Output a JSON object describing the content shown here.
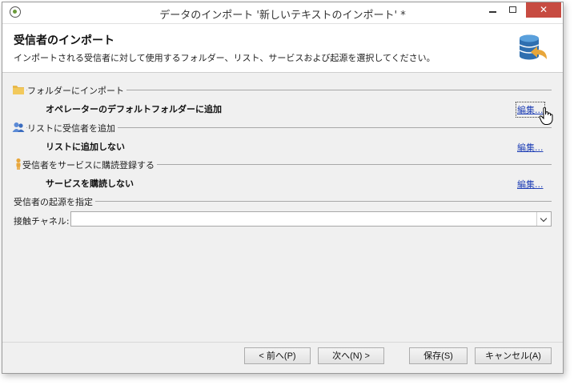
{
  "window": {
    "title": "データのインポート '新しいテキストのインポート' *",
    "close_glyph": "✕"
  },
  "header": {
    "title": "受信者のインポート",
    "subtitle": "インポートされる受信者に対して使用するフォルダー、リスト、サービスおよび起源を選択してください。"
  },
  "sections": {
    "folder": {
      "label": "フォルダーにインポート",
      "value": "オペレーターのデフォルトフォルダーに追加",
      "edit": "編集..."
    },
    "list": {
      "label": "リストに受信者を追加",
      "value": "リストに追加しない",
      "edit": "編集..."
    },
    "service": {
      "label": "受信者をサービスに購読登録する",
      "value": "サービスを購読しない",
      "edit": "編集..."
    },
    "origin": {
      "label": "受信者の起源を指定",
      "channel_label": "接触チャネル:",
      "channel_value": ""
    }
  },
  "buttons": {
    "prev": "< 前へ(P)",
    "next": "次へ(N) >",
    "save": "保存(S)",
    "cancel": "キャンセル(A)"
  },
  "colors": {
    "link": "#1f3fb5",
    "close": "#c74b41",
    "folder_icon": "#e8b84a",
    "db_icon": "#2f6fb0"
  }
}
